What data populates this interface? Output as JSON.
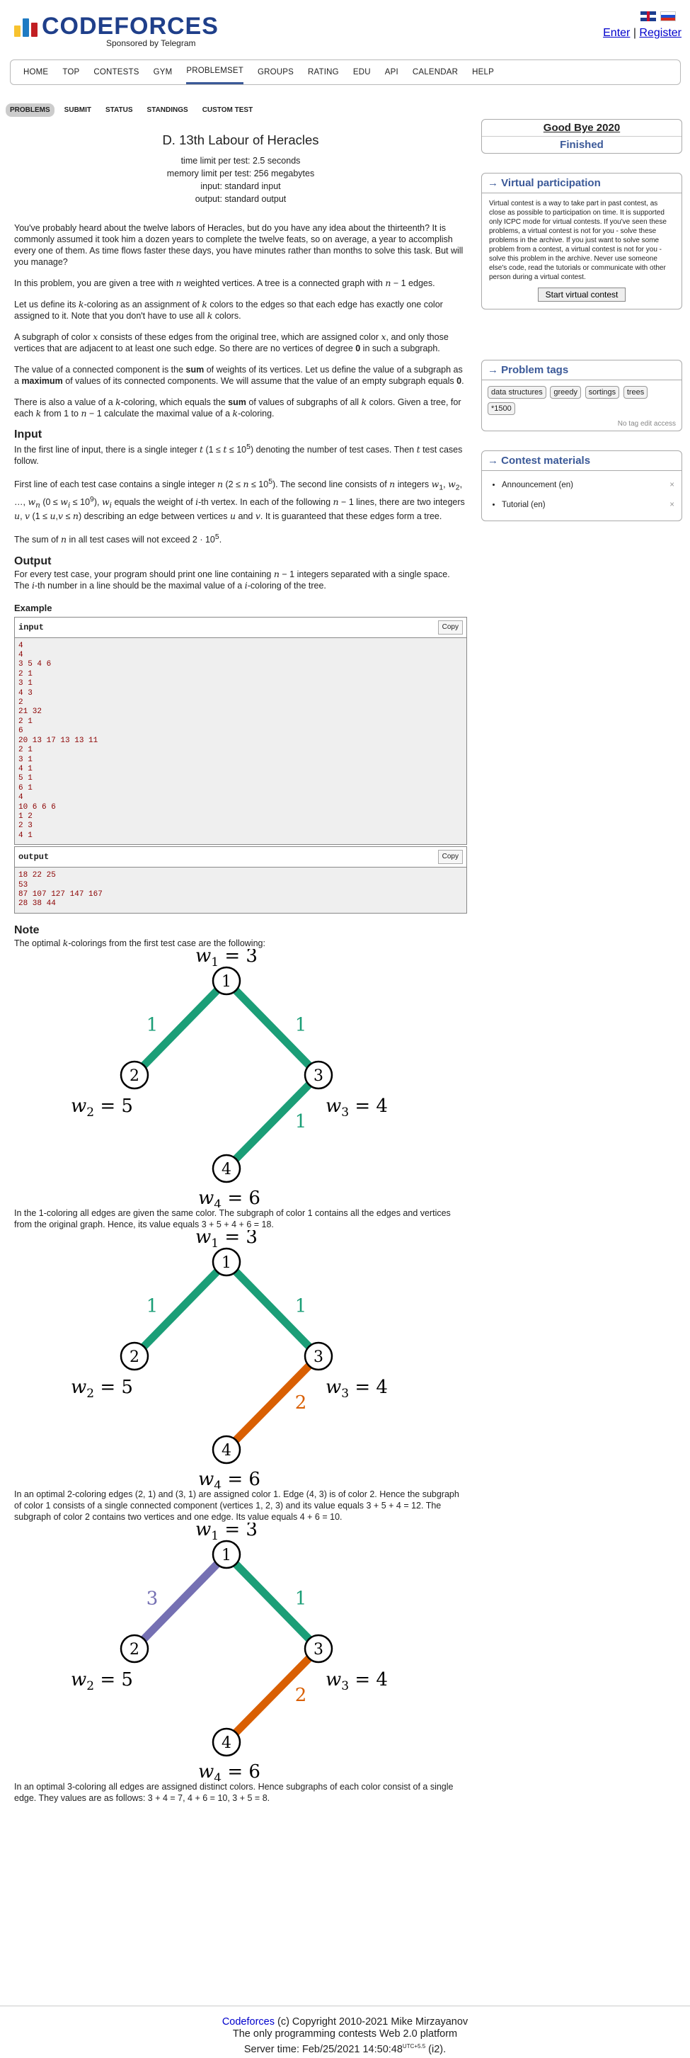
{
  "site": {
    "logo": "CODEFORCES",
    "tagline": "Sponsored by Telegram",
    "enter": "Enter",
    "register": "Register"
  },
  "nav": [
    "HOME",
    "TOP",
    "CONTESTS",
    "GYM",
    "PROBLEMSET",
    "GROUPS",
    "RATING",
    "EDU",
    "API",
    "CALENDAR",
    "HELP"
  ],
  "subtabs": [
    "PROBLEMS",
    "SUBMIT",
    "STATUS",
    "STANDINGS",
    "CUSTOM TEST"
  ],
  "problem": {
    "title": "D. 13th Labour of Heracles",
    "time": "time limit per test: 2.5 seconds",
    "memory": "memory limit per test: 256 megabytes",
    "input": "input: standard input",
    "output": "output: standard output",
    "p1": "You've probably heard about the twelve labors of Heracles, but do you have any idea about the thirteenth? It is commonly assumed it took him a dozen years to complete the twelve feats, so on average, a year to accomplish every one of them. As time flows faster these days, you have minutes rather than months to solve this task. But will you manage?",
    "input_h": "Input",
    "output_h": "Output",
    "example_h": "Example",
    "note_h": "Note",
    "sample_in": "4\n4\n3 5 4 6\n2 1\n3 1\n4 3\n2\n21 32\n2 1\n6\n20 13 17 13 13 11\n2 1\n3 1\n4 1\n5 1\n6 1\n4\n10 6 6 6\n1 2\n2 3\n4 1",
    "sample_out": "18 22 25\n53\n87 107 127 147 167\n28 38 44",
    "input_label": "input",
    "output_label": "output",
    "copy": "Copy"
  },
  "sidebar": {
    "contest": "Good Bye 2020",
    "status": "Finished",
    "vp_title": "→ Virtual participation",
    "vp_text": "Virtual contest is a way to take part in past contest, as close as possible to participation on time. It is supported only ICPC mode for virtual contests. If you've seen these problems, a virtual contest is not for you - solve these problems in the archive. If you just want to solve some problem from a contest, a virtual contest is not for you - solve this problem in the archive. Never use someone else's code, read the tutorials or communicate with other person during a virtual contest.",
    "vp_button": "Start virtual contest",
    "tags_title": "→ Problem tags",
    "tags": [
      "data structures",
      "greedy",
      "sortings",
      "trees",
      "*1500"
    ],
    "no_tag": "No tag edit access",
    "cm_title": "→ Contest materials",
    "materials": [
      "Announcement (en)",
      "Tutorial (en)"
    ]
  },
  "footer": {
    "link": "Codeforces",
    "l1": " (c) Copyright 2010-2021 Mike Mirzayanov",
    "l2": "The only programming contests Web 2.0 platform",
    "l3": "Server time: Feb/25/2021 14:50:48",
    "sup": "UTC+5.5",
    "l3b": " (i2)."
  },
  "colors": {
    "green": "#1b9e77",
    "orange": "#d95f02",
    "purple": "#7570b3",
    "brand": "#3b5998"
  }
}
